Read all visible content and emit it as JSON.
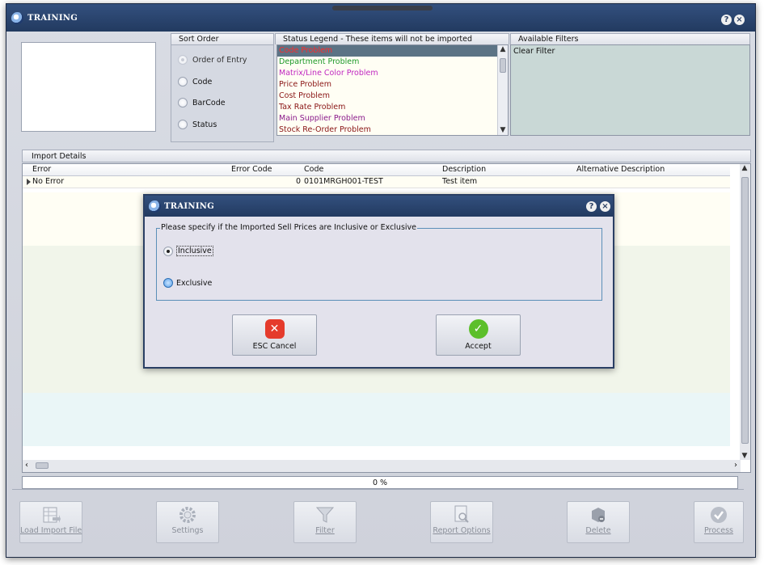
{
  "window": {
    "title": "TRAINING"
  },
  "sort_order": {
    "header": "Sort Order",
    "options": [
      "Order of Entry",
      "Code",
      "BarCode",
      "Status"
    ]
  },
  "status_legend": {
    "header": "Status Legend - These items will not be imported",
    "items": [
      {
        "label": "Code Problem",
        "color": "#ff2a2a"
      },
      {
        "label": "Department Problem",
        "color": "#1f9a2a"
      },
      {
        "label": "Matrix/Line Color Problem",
        "color": "#c026c0"
      },
      {
        "label": "Price Problem",
        "color": "#8a1515"
      },
      {
        "label": "Cost Problem",
        "color": "#8a1515"
      },
      {
        "label": "Tax Rate Problem",
        "color": "#8a1515"
      },
      {
        "label": "Main Supplier Problem",
        "color": "#8a1a8a"
      },
      {
        "label": "Stock Re-Order Problem",
        "color": "#8a1515"
      }
    ]
  },
  "available_filters": {
    "header": "Available Filters",
    "items": [
      "Clear Filter"
    ]
  },
  "import_details": {
    "header": "Import Details",
    "columns": [
      "Error",
      "Error Code",
      "Code",
      "Description",
      "Alternative Description"
    ],
    "rows": [
      {
        "error": "No Error",
        "error_code": "0",
        "code": "0101MRGH001-TEST",
        "description": "Test item",
        "alt_description": ""
      }
    ],
    "progress_text": "0 %"
  },
  "toolbar": {
    "load_import_file": "Load Import File",
    "settings": "Settings",
    "filter": "Filter",
    "report_options": "Report Options",
    "delete": "Delete",
    "process": "Process"
  },
  "dialog": {
    "title": "TRAINING",
    "question": "Please specify if the Imported Sell Prices are Inclusive or Exclusive",
    "option_inclusive": "Inclusive",
    "option_exclusive": "Exclusive",
    "cancel_label": "ESC Cancel",
    "accept_label": "Accept"
  },
  "colors": {
    "title_bar": "#2b4470",
    "legend_selected": "#5c7385",
    "filter_bg": "#c9d8d6",
    "cancel_red": "#e53b2c",
    "accept_green": "#5cbf2a"
  }
}
